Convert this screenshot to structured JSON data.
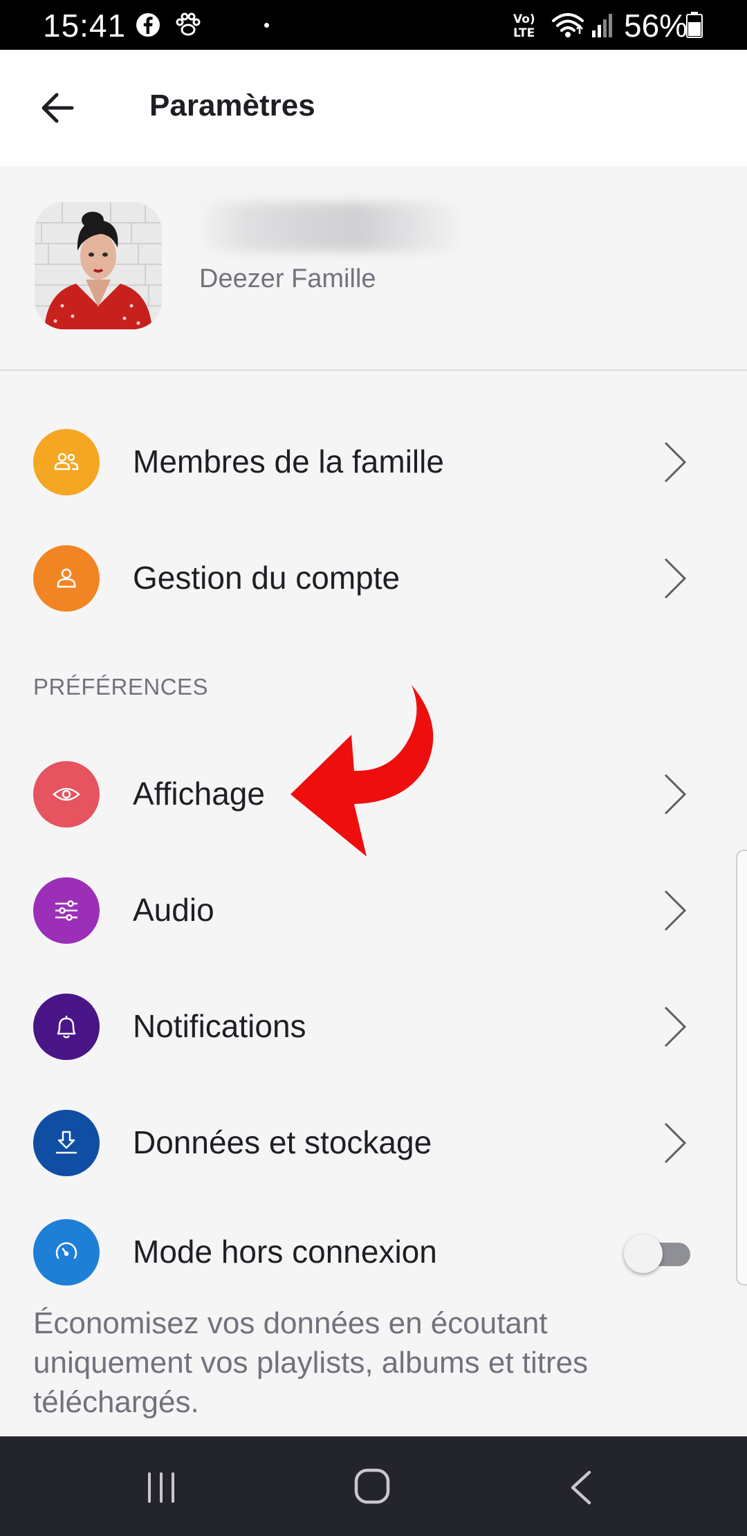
{
  "status_bar": {
    "time": "15:41",
    "battery": "56%",
    "icons": [
      "facebook-icon",
      "paw-icon",
      "volte-icon",
      "wifi-icon",
      "signal-icon",
      "battery-icon"
    ]
  },
  "header": {
    "title": "Paramètres",
    "back_icon": "arrow-left-icon"
  },
  "profile": {
    "plan": "Deezer Famille"
  },
  "account_items": [
    {
      "label": "Membres de la famille",
      "icon": "family-icon",
      "color": "#f5a623"
    },
    {
      "label": "Gestion du compte",
      "icon": "user-icon",
      "color": "#f28523"
    }
  ],
  "preferences": {
    "header": "PRÉFÉRENCES",
    "items": [
      {
        "label": "Affichage",
        "icon": "eye-icon",
        "color": "#e5545f"
      },
      {
        "label": "Audio",
        "icon": "sliders-icon",
        "color": "#9c2fb8"
      },
      {
        "label": "Notifications",
        "icon": "bell-icon",
        "color": "#4a1587"
      },
      {
        "label": "Données et stockage",
        "icon": "download-icon",
        "color": "#0f4ea3"
      },
      {
        "label": "Mode hors connexion",
        "icon": "gauge-icon",
        "color": "#1e7fd6"
      }
    ],
    "offline_toggle": false,
    "offline_description": "Économisez vos données en écoutant uniquement vos playlists, albums et titres téléchargés."
  },
  "colors": {
    "annotation_arrow": "#ee0e0e",
    "background": "#f5f5f6"
  }
}
